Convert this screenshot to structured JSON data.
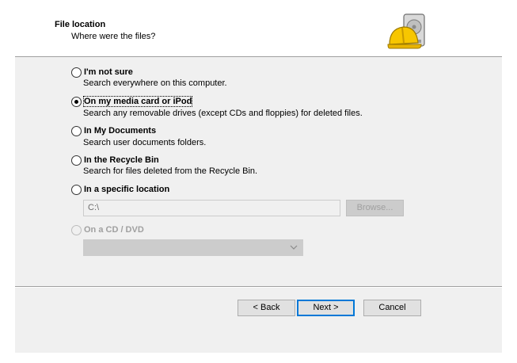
{
  "header": {
    "title": "File location",
    "subtitle": "Where were the files?",
    "icon": "hard-drive-hardhat-icon"
  },
  "options": [
    {
      "id": "not-sure",
      "label": "I'm not sure",
      "desc": "Search everywhere on this computer.",
      "checked": false,
      "enabled": true
    },
    {
      "id": "media-card",
      "label": "On my media card or iPod",
      "desc": "Search any removable drives (except CDs and floppies) for deleted files.",
      "checked": true,
      "enabled": true
    },
    {
      "id": "my-documents",
      "label": "In My Documents",
      "desc": "Search user documents folders.",
      "checked": false,
      "enabled": true
    },
    {
      "id": "recycle-bin",
      "label": "In the Recycle Bin",
      "desc": "Search for files deleted from the Recycle Bin.",
      "checked": false,
      "enabled": true
    },
    {
      "id": "specific-location",
      "label": "In a specific location",
      "desc": "",
      "checked": false,
      "enabled": true
    },
    {
      "id": "cd-dvd",
      "label": "On a CD / DVD",
      "desc": "",
      "checked": false,
      "enabled": false
    }
  ],
  "location": {
    "value": "C:\\",
    "browse_label": "Browse..."
  },
  "cd_combo": {
    "value": ""
  },
  "buttons": {
    "back": "< Back",
    "next": "Next >",
    "cancel": "Cancel"
  },
  "colors": {
    "panel": "#f0f0f0",
    "accent": "#0078d7",
    "icon_yellow": "#f7c600"
  }
}
